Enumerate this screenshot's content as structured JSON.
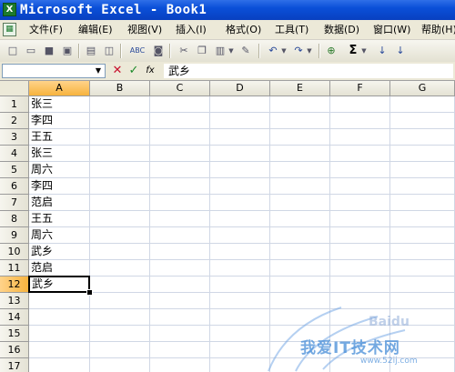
{
  "window": {
    "title": "Microsoft Excel - Book1"
  },
  "menubar": {
    "items": [
      "文件(F)",
      "编辑(E)",
      "视图(V)",
      "插入(I)",
      "格式(O)",
      "工具(T)",
      "数据(D)",
      "窗口(W)",
      "帮助(H)"
    ]
  },
  "toolbar": {
    "icons": [
      "new-document-icon",
      "open-folder-icon",
      "save-icon",
      "permission-icon",
      "print-icon",
      "print-preview-icon",
      "spelling-icon",
      "research-icon",
      "cut-icon",
      "copy-icon",
      "paste-icon",
      "format-painter-icon",
      "undo-icon",
      "redo-icon",
      "hyperlink-icon",
      "autosum-icon",
      "sort-ascending-icon",
      "sort-descending-icon"
    ],
    "glyphs": {
      "new": "□",
      "open": "▭",
      "save": "■",
      "permission": "▣",
      "print": "▤",
      "preview": "◫",
      "spelling": "ABC",
      "research": "◙",
      "cut": "✂",
      "copy": "❐",
      "paste": "▥",
      "painter": "✎",
      "undo": "↶",
      "redo": "↷",
      "hyperlink": "⊕",
      "autosum": "Σ",
      "sort_asc": "↓",
      "sort_desc": "↓"
    }
  },
  "formula_bar": {
    "name_box_value": "",
    "dropdown_glyph": "▼",
    "cancel_glyph": "✕",
    "enter_glyph": "✓",
    "function_glyph": "fx",
    "content": "武乡"
  },
  "grid": {
    "columns": [
      "A",
      "B",
      "C",
      "D",
      "E",
      "F",
      "G"
    ],
    "rows": [
      "1",
      "2",
      "3",
      "4",
      "5",
      "6",
      "7",
      "8",
      "9",
      "10",
      "11",
      "12",
      "13",
      "14",
      "15",
      "16",
      "17"
    ],
    "active_column": "A",
    "active_row": "12",
    "column_a_values": [
      "张三",
      "李四",
      "王五",
      "张三",
      "周六",
      "李四",
      "范启",
      "王五",
      "周六",
      "武乡",
      "范启",
      "武乡"
    ]
  },
  "colors": {
    "title_bar": "#0a4fd8",
    "active_header": "#f7b33e",
    "watermark": "#468cd7"
  },
  "watermark": {
    "text": "我爱IT技术网",
    "url": "www.52ij.com",
    "brand": "Baidu"
  }
}
